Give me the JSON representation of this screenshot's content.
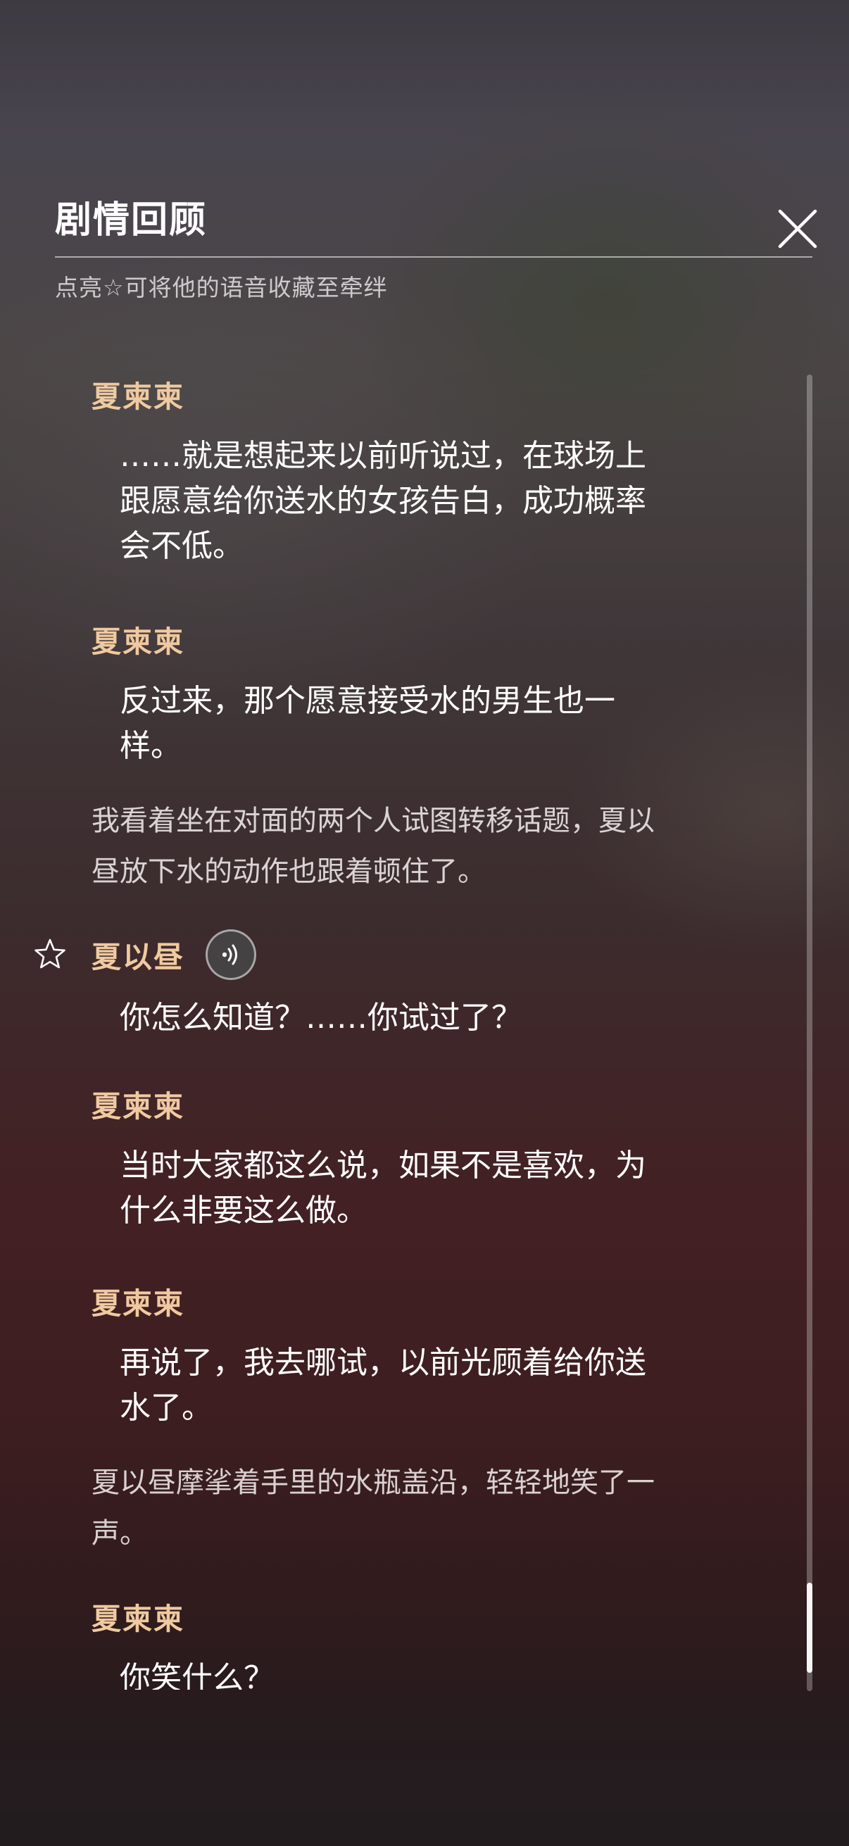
{
  "header": {
    "title": "剧情回顾",
    "hint": "点亮☆可将他的语音收藏至牵绊"
  },
  "colors": {
    "speaker_name": "#f0c9a0",
    "dialogue_text": "#ffffff",
    "narration_text": "#ebe6e6"
  },
  "icons": {
    "close": "close-icon",
    "star": "star-outline-icon",
    "voice": "voice-play-icon"
  },
  "entries": [
    {
      "type": "dialogue",
      "speaker": "夏柬柬",
      "lines": [
        "……就是想起来以前听说过，在球场上",
        "跟愿意给你送水的女孩告白，成功概率",
        "会不低。"
      ]
    },
    {
      "type": "dialogue",
      "speaker": "夏柬柬",
      "lines": [
        "反过来，那个愿意接受水的男生也一",
        "样。"
      ]
    },
    {
      "type": "narration",
      "lines": [
        "我看着坐在对面的两个人试图转移话题，夏以",
        "昼放下水的动作也跟着顿住了。"
      ]
    },
    {
      "type": "dialogue",
      "speaker": "夏以昼",
      "favoritable": true,
      "has_voice": true,
      "lines": [
        "你怎么知道？……你试过了？"
      ]
    },
    {
      "type": "dialogue",
      "speaker": "夏柬柬",
      "lines": [
        "当时大家都这么说，如果不是喜欢，为",
        "什么非要这么做。"
      ]
    },
    {
      "type": "dialogue",
      "speaker": "夏柬柬",
      "lines": [
        "再说了，我去哪试，以前光顾着给你送",
        "水了。"
      ]
    },
    {
      "type": "narration",
      "lines": [
        "夏以昼摩挲着手里的水瓶盖沿，轻轻地笑了一",
        "声。"
      ]
    },
    {
      "type": "dialogue",
      "speaker": "夏柬柬",
      "lines": [
        "你笑什么？"
      ]
    }
  ]
}
